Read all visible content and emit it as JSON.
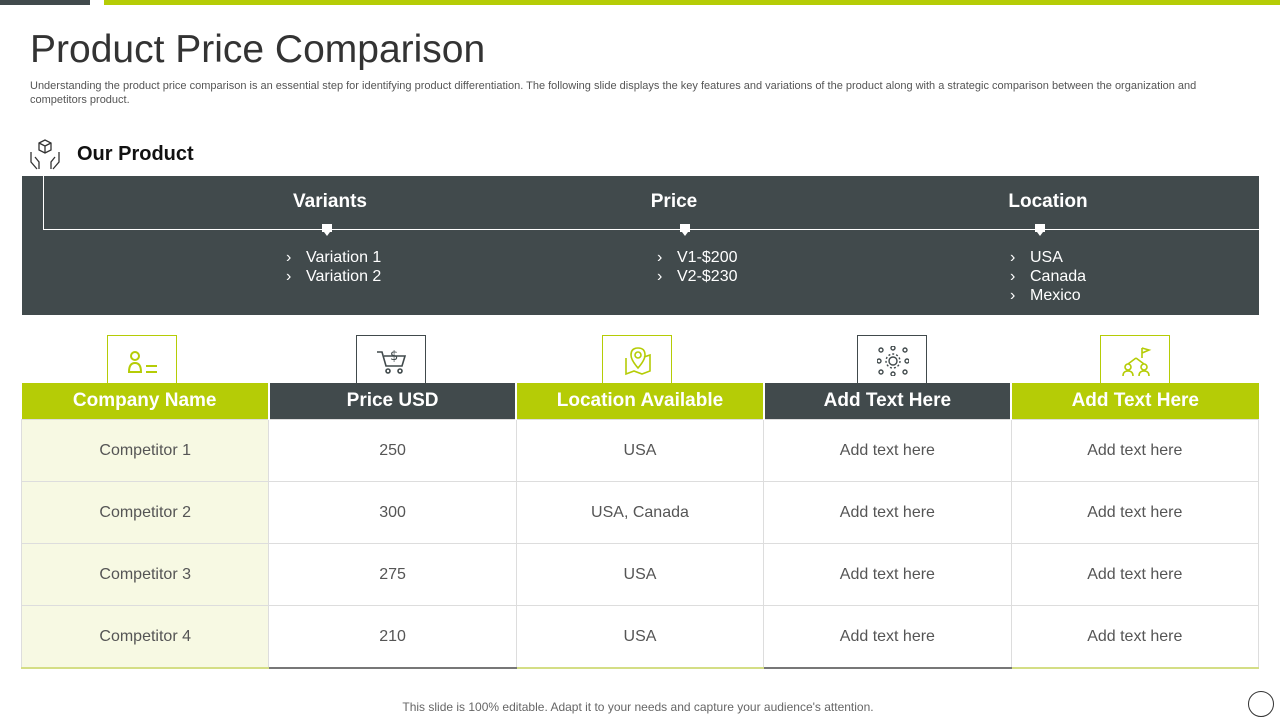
{
  "colors": {
    "lime": "#b5cc06",
    "dark": "#414a4c"
  },
  "title": "Product Price Comparison",
  "subtitle": "Understanding the product price comparison is an essential step for identifying product differentiation. The following slide displays the key features and variations of the product along with a strategic comparison between the organization and competitors product.",
  "our_product": {
    "heading": "Our Product",
    "icon": "hands-holding-box-icon",
    "columns": [
      {
        "label": "Variants",
        "items": [
          "Variation 1",
          "Variation 2"
        ]
      },
      {
        "label": "Price",
        "items": [
          "V1-$200",
          "V2-$230"
        ]
      },
      {
        "label": "Location",
        "items": [
          "USA",
          "Canada",
          "Mexico"
        ]
      }
    ]
  },
  "comparison": {
    "headers": [
      {
        "label": "Company Name",
        "icon": "person-list-icon"
      },
      {
        "label": "Price USD",
        "icon": "cart-dollar-icon"
      },
      {
        "label": "Location Available",
        "icon": "map-pin-icon"
      },
      {
        "label": "Add Text Here",
        "icon": "network-gear-icon"
      },
      {
        "label": "Add Text Here",
        "icon": "team-flag-icon"
      }
    ],
    "rows": [
      [
        "Competitor 1",
        "250",
        "USA",
        "Add text here",
        "Add text here"
      ],
      [
        "Competitor 2",
        "300",
        "USA, Canada",
        "Add text here",
        "Add text here"
      ],
      [
        "Competitor 3",
        "275",
        "USA",
        "Add text here",
        "Add text here"
      ],
      [
        "Competitor 4",
        "210",
        "USA",
        "Add text here",
        "Add text here"
      ]
    ]
  },
  "footer": "This slide is 100% editable. Adapt it to your needs and capture your audience's attention."
}
